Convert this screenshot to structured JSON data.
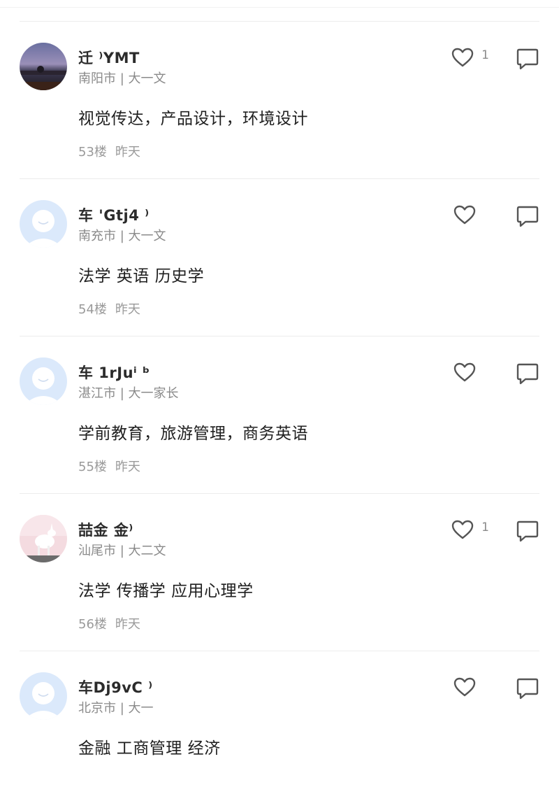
{
  "comments": [
    {
      "user": "迁 ⁾YMT",
      "meta": "南阳市 | 大一文",
      "text": "视觉传达，产品设计，环境设计",
      "floor": "53楼",
      "time": "昨天",
      "likes": "1",
      "avatar": "photo-dusk-sky"
    },
    {
      "user": "车 'Gtj4 ⁾",
      "meta": "南充市 | 大一文",
      "text": "法学 英语 历史学",
      "floor": "54楼",
      "time": "昨天",
      "likes": "",
      "avatar": "default-avatar"
    },
    {
      "user": "车 1rJuⁱ ᵇ",
      "meta": "湛江市 | 大一家长",
      "text": "学前教育，旅游管理，商务英语",
      "floor": "55楼",
      "time": "昨天",
      "likes": "",
      "avatar": "default-avatar"
    },
    {
      "user": "喆金 金⁾",
      "meta": "汕尾市 | 大二文",
      "text": "法学 传播学 应用心理学",
      "floor": "56楼",
      "time": "昨天",
      "likes": "1",
      "avatar": "photo-pink-animal"
    },
    {
      "user": "车Dj9vC ⁾",
      "meta": "北京市 | 大一",
      "text": "金融 工商管理 经济",
      "floor": "",
      "time": "",
      "likes": "",
      "avatar": "default-avatar"
    }
  ],
  "icons": {
    "like": "heart-outline-icon",
    "reply": "speech-bubble-icon"
  },
  "colors": {
    "default_avatar_bg": "#dbe9fb",
    "default_avatar_face": "#ffffff",
    "icon_stroke": "#555555",
    "meta_text": "#8a8a8a",
    "body_text": "#1f1f1f"
  }
}
